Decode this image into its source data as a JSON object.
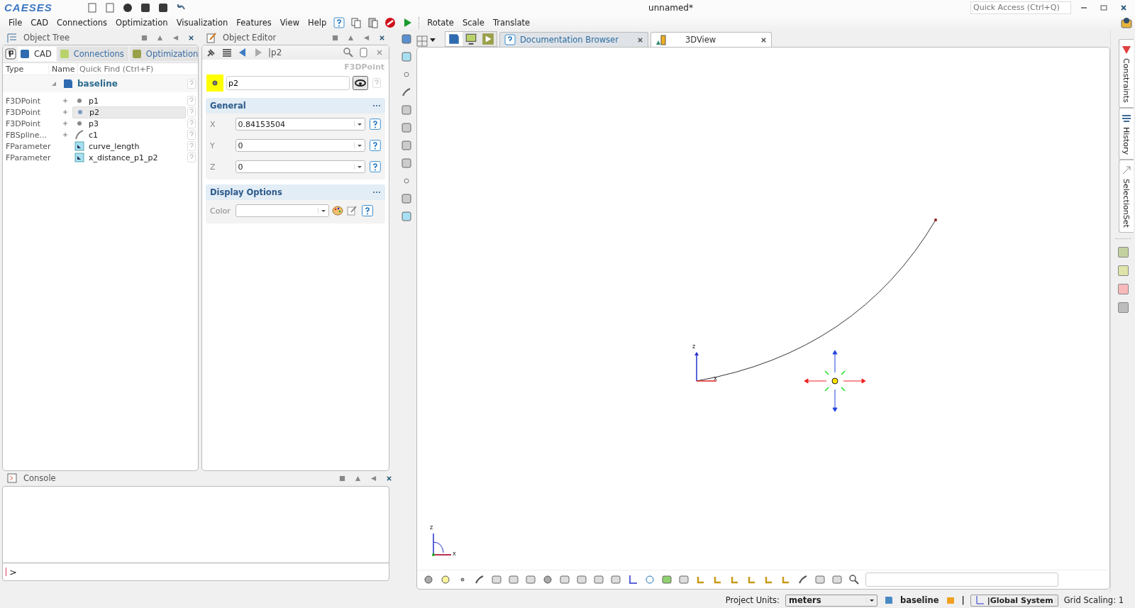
{
  "window": {
    "logo": "CAESES",
    "title": "unnamed*",
    "quick_access": {
      "placeholder": "Quick Access (Ctrl+Q)"
    }
  },
  "menu": [
    "File",
    "CAD",
    "Connections",
    "Optimization",
    "Visualization",
    "Features",
    "View",
    "Help"
  ],
  "transform_tools": [
    "Rotate",
    "Scale",
    "Translate"
  ],
  "object_tree": {
    "title": "Object Tree",
    "tabs": [
      {
        "label": "CAD",
        "selected": true
      },
      {
        "label": "Connections",
        "selected": false
      },
      {
        "label": "Optimization",
        "selected": false
      }
    ],
    "columns": [
      "Type",
      "Name"
    ],
    "search": {
      "placeholder": "Quick Find (Ctrl+F)"
    },
    "root": {
      "name": "baseline",
      "expanded": true,
      "children": [
        {
          "type": "F3DPoint",
          "name": "p1",
          "kind": "point",
          "expandable": true,
          "selected": false
        },
        {
          "type": "F3DPoint",
          "name": "p2",
          "kind": "point",
          "expandable": true,
          "selected": true
        },
        {
          "type": "F3DPoint",
          "name": "p3",
          "kind": "point",
          "expandable": true,
          "selected": false
        },
        {
          "type": "FBSpline...",
          "name": "c1",
          "kind": "curve",
          "expandable": true,
          "selected": false
        },
        {
          "type": "FParameter",
          "name": "curve_length",
          "kind": "parameter",
          "expandable": false,
          "selected": false
        },
        {
          "type": "FParameter",
          "name": "x_distance_p1_p2",
          "kind": "parameter",
          "expandable": false,
          "selected": false
        }
      ]
    }
  },
  "object_editor": {
    "title": "Object Editor",
    "path": "|p2",
    "type": "F3DPoint",
    "name": {
      "value": "p2"
    },
    "sections": [
      {
        "title": "General",
        "fields": [
          {
            "label": "X",
            "kind": "number",
            "value": "0.84153504"
          },
          {
            "label": "Y",
            "kind": "number",
            "value": "0"
          },
          {
            "label": "Z",
            "kind": "number",
            "value": "0"
          }
        ]
      },
      {
        "title": "Display Options",
        "fields": [
          {
            "label": "Color",
            "kind": "color"
          }
        ]
      }
    ]
  },
  "console": {
    "title": "Console",
    "prompt": ">"
  },
  "view_tabs": [
    {
      "label": "Documentation Browser",
      "selected": false
    },
    {
      "label": "3DView",
      "selected": true
    }
  ],
  "scene": {
    "axis_labels": [
      "z",
      "x"
    ],
    "triad_labels": [
      "z",
      "x"
    ]
  },
  "side_tabs": [
    "Constraints",
    "History",
    "SelectionSet"
  ],
  "swatches": [
    {
      "color": "#c3d1a0"
    },
    {
      "color": "#dfe4a9"
    },
    {
      "color": "#f7b9b9"
    },
    {
      "color": "#bdbdbd"
    }
  ],
  "status_bar": {
    "units_label": "Project Units:",
    "units": "meters",
    "design": "baseline",
    "variant": "|",
    "coordinate_system": "|Global System",
    "grid_scaling": "Grid Scaling: 1"
  }
}
